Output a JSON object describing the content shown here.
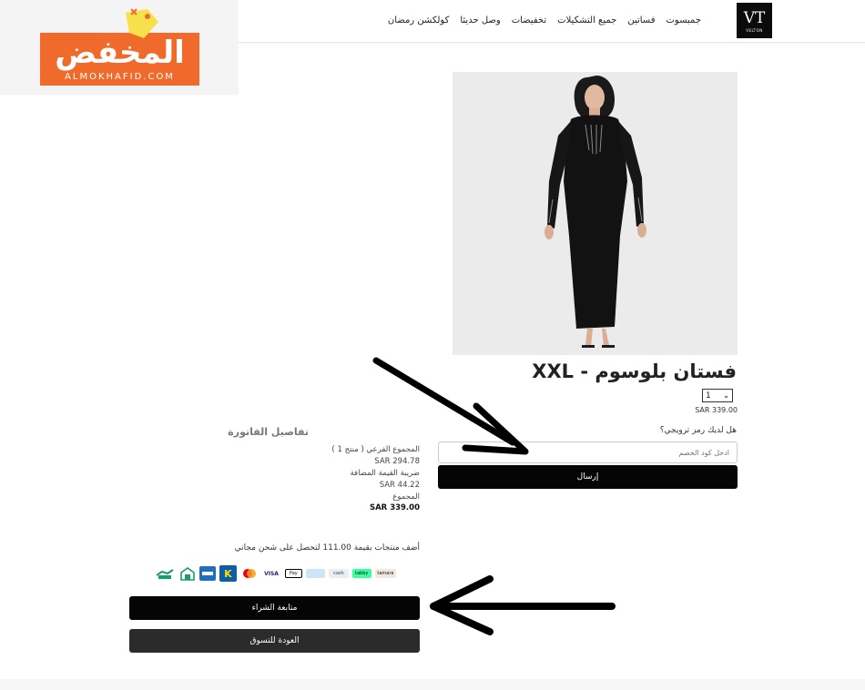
{
  "nav": {
    "items": [
      "كولكشن رمضان",
      "وصل حديثا",
      "تخفيضات",
      "جميع التشكيلات",
      "فساتين",
      "جمبسوت"
    ]
  },
  "brand": {
    "monogram": "VT",
    "name": "VELTON"
  },
  "watermark": {
    "arabic": "المخفض",
    "latin": "ALMOKHAFID.COM",
    "color": "#ef6a2b"
  },
  "product": {
    "title": "فستان بلوسوم - XXL",
    "quantity": "1",
    "price": "SAR 339.00"
  },
  "promo": {
    "question": "هل لديك رمز ترويجي؟",
    "placeholder": "ادخل كود الخصم",
    "submit_label": "إرسال"
  },
  "invoice": {
    "title": "تفاصيل الفاتورة",
    "subtotal_label": "المجموع الفرعي ( منتج 1 )",
    "subtotal_value": "SAR 294.78",
    "vat_label": "ضريبة القيمة المضافة",
    "vat_value": "SAR 44.22",
    "total_label": "المجموع",
    "total_value": "SAR 339.00"
  },
  "shipping_message": "أضف منتجات بقيمة 111.00 لتحصل على شحن مجاني",
  "payment_methods": [
    {
      "name": "tamara",
      "label": "tamara",
      "bg": "#f1e9df",
      "fg": "#222"
    },
    {
      "name": "tabby",
      "label": "tabby",
      "bg": "#3bff9d",
      "fg": "#111"
    },
    {
      "name": "bank-transfer",
      "label": "cash",
      "bg": "#e8eef3",
      "fg": "#345"
    },
    {
      "name": "stc-pay",
      "label": "",
      "bg": "#cde5f5",
      "fg": "#345"
    },
    {
      "name": "apple-pay",
      "label": "Pay",
      "bg": "#ffffff",
      "fg": "#000"
    },
    {
      "name": "visa",
      "label": "VISA",
      "bg": "#ffffff",
      "fg": "#1a1f71"
    },
    {
      "name": "mastercard",
      "label": "",
      "bg": "#ffffff",
      "fg": "#000"
    },
    {
      "name": "knet",
      "label": "K",
      "bg": "#0a5fa8",
      "fg": "#ffdd00"
    },
    {
      "name": "amex",
      "label": "",
      "bg": "#1e6fbf",
      "fg": "#fff"
    },
    {
      "name": "cod",
      "label": "",
      "bg": "#ffffff",
      "fg": "#1b9b6e"
    },
    {
      "name": "installments",
      "label": "",
      "bg": "#ffffff",
      "fg": "#1b9b6e"
    }
  ],
  "buttons": {
    "checkout": "متابعة الشراء",
    "continue_shopping": "العودة للتسوق"
  }
}
